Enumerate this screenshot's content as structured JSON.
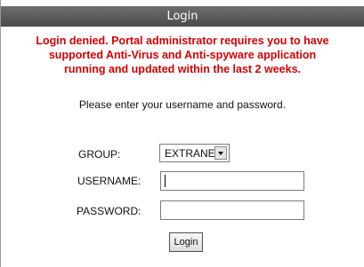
{
  "header": {
    "title": "Login"
  },
  "error": {
    "lines": [
      "Login denied. Portal administrator requires you to have",
      "supported Anti-Virus and Anti-spyware application",
      "running and updated within the last 2 weeks."
    ],
    "color": "#d40000"
  },
  "instruction": "Please enter your username and password.",
  "form": {
    "group_label": "GROUP:",
    "group_value": "EXTRANET",
    "username_label": "USERNAME:",
    "username_value": "",
    "password_label": "PASSWORD:",
    "password_value": "",
    "login_label": "Login"
  }
}
